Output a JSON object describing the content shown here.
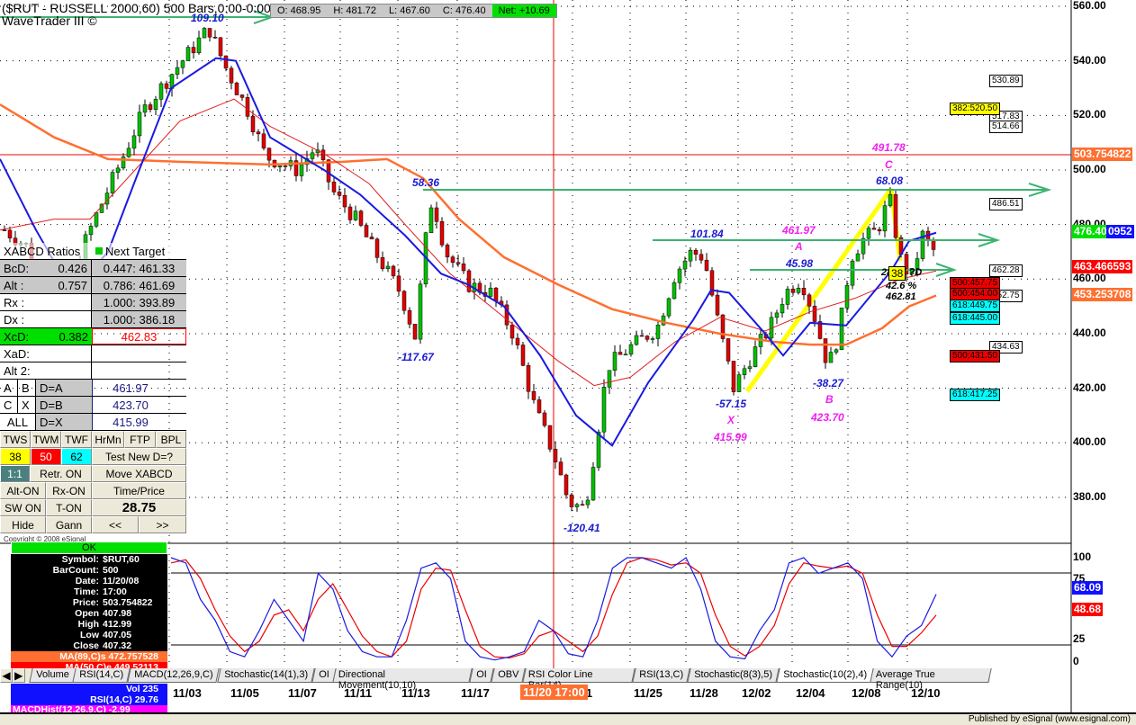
{
  "header": {
    "title": "($RUT - RUSSELL 2000,60) 500 Bars,0:00-0:00",
    "subtitle": "WaveTrader III ©",
    "open": "O: 468.95",
    "high": "H: 481.72",
    "low": "L: 467.60",
    "close": "C: 476.40",
    "net": "Net: +10.69"
  },
  "chart_data": {
    "type": "candlestick",
    "symbol": "$RUT",
    "interval": "60",
    "ylim": [
      370,
      562
    ],
    "y_ticks": [
      "560.00",
      "540.00",
      "520.00",
      "500.00",
      "480.00",
      "460.00",
      "440.00",
      "420.00",
      "400.00",
      "380.00"
    ],
    "x_ticks": [
      "11/03",
      "11/05",
      "11/07",
      "11/11",
      "11/13",
      "11/17",
      "/21",
      "11/25",
      "11/28",
      "12/02",
      "12/04",
      "12/08",
      "12/10"
    ],
    "cursor_label": "11/20 17:00",
    "price_path": [
      [
        5,
        478
      ],
      [
        30,
        472
      ],
      [
        55,
        448
      ],
      [
        75,
        446
      ],
      [
        90,
        470
      ],
      [
        105,
        482
      ],
      [
        130,
        500
      ],
      [
        160,
        522
      ],
      [
        190,
        535
      ],
      [
        215,
        545
      ],
      [
        232,
        552
      ],
      [
        250,
        538
      ],
      [
        275,
        522
      ],
      [
        295,
        505
      ],
      [
        330,
        500
      ],
      [
        350,
        508
      ],
      [
        370,
        492
      ],
      [
        395,
        482
      ],
      [
        420,
        468
      ],
      [
        445,
        455
      ],
      [
        462,
        438
      ],
      [
        470,
        468
      ],
      [
        480,
        490
      ],
      [
        495,
        470
      ],
      [
        520,
        458
      ],
      [
        545,
        455
      ],
      [
        570,
        440
      ],
      [
        595,
        412
      ],
      [
        615,
        396
      ],
      [
        632,
        378
      ],
      [
        650,
        376
      ],
      [
        662,
        400
      ],
      [
        675,
        428
      ],
      [
        700,
        435
      ],
      [
        730,
        442
      ],
      [
        750,
        462
      ],
      [
        768,
        470
      ],
      [
        782,
        468
      ],
      [
        795,
        448
      ],
      [
        815,
        420
      ],
      [
        835,
        432
      ],
      [
        855,
        442
      ],
      [
        872,
        455
      ],
      [
        890,
        460
      ],
      [
        905,
        446
      ],
      [
        920,
        428
      ],
      [
        932,
        440
      ],
      [
        945,
        468
      ],
      [
        960,
        475
      ],
      [
        975,
        478
      ],
      [
        988,
        490
      ],
      [
        1000,
        468
      ],
      [
        1012,
        460
      ],
      [
        1025,
        476
      ],
      [
        1038,
        470
      ]
    ],
    "ma_blue": [
      [
        0,
        504
      ],
      [
        40,
        478
      ],
      [
        80,
        455
      ],
      [
        120,
        470
      ],
      [
        150,
        496
      ],
      [
        190,
        530
      ],
      [
        240,
        541
      ],
      [
        262,
        540
      ],
      [
        300,
        512
      ],
      [
        360,
        500
      ],
      [
        400,
        491
      ],
      [
        450,
        476
      ],
      [
        490,
        462
      ],
      [
        520,
        458
      ],
      [
        560,
        450
      ],
      [
        600,
        432
      ],
      [
        640,
        410
      ],
      [
        680,
        399
      ],
      [
        720,
        422
      ],
      [
        770,
        445
      ],
      [
        790,
        456
      ],
      [
        810,
        455
      ],
      [
        850,
        440
      ],
      [
        870,
        432
      ],
      [
        900,
        444
      ],
      [
        940,
        443
      ],
      [
        965,
        453
      ],
      [
        990,
        463
      ],
      [
        1010,
        474
      ],
      [
        1040,
        477
      ]
    ],
    "ma_red": [
      [
        0,
        478
      ],
      [
        60,
        482
      ],
      [
        100,
        482
      ],
      [
        150,
        500
      ],
      [
        200,
        518
      ],
      [
        260,
        526
      ],
      [
        300,
        516
      ],
      [
        360,
        506
      ],
      [
        410,
        495
      ],
      [
        450,
        480
      ],
      [
        500,
        462
      ],
      [
        560,
        446
      ],
      [
        620,
        430
      ],
      [
        660,
        421
      ],
      [
        700,
        424
      ],
      [
        750,
        437
      ],
      [
        800,
        446
      ],
      [
        850,
        441
      ],
      [
        900,
        448
      ],
      [
        950,
        453
      ],
      [
        1000,
        460
      ],
      [
        1040,
        463
      ]
    ],
    "ma_orange": [
      [
        0,
        524
      ],
      [
        60,
        512
      ],
      [
        120,
        504
      ],
      [
        200,
        503
      ],
      [
        300,
        502
      ],
      [
        380,
        503
      ],
      [
        430,
        504
      ],
      [
        470,
        497
      ],
      [
        510,
        482
      ],
      [
        560,
        468
      ],
      [
        620,
        458
      ],
      [
        680,
        449
      ],
      [
        740,
        444
      ],
      [
        800,
        440
      ],
      [
        860,
        437
      ],
      [
        900,
        436
      ],
      [
        940,
        436
      ],
      [
        980,
        442
      ],
      [
        1010,
        450
      ],
      [
        1040,
        454
      ]
    ],
    "stoch_blue": [
      100,
      95,
      60,
      40,
      10,
      5,
      30,
      60,
      40,
      20,
      85,
      70,
      30,
      10,
      5,
      5,
      40,
      90,
      95,
      80,
      20,
      5,
      2,
      5,
      10,
      40,
      30,
      8,
      5,
      40,
      90,
      100,
      100,
      95,
      90,
      100,
      70,
      20,
      5,
      3,
      30,
      50,
      95,
      100,
      85,
      90,
      95,
      80,
      20,
      5,
      25,
      35,
      65
    ],
    "stoch_red": [
      95,
      98,
      80,
      50,
      25,
      10,
      20,
      45,
      50,
      30,
      60,
      75,
      50,
      25,
      10,
      5,
      20,
      70,
      90,
      88,
      50,
      15,
      5,
      4,
      8,
      25,
      30,
      20,
      10,
      25,
      65,
      95,
      100,
      98,
      93,
      95,
      85,
      45,
      15,
      6,
      15,
      35,
      75,
      95,
      92,
      90,
      92,
      85,
      45,
      15,
      15,
      28,
      45
    ],
    "stoch_ticks": [
      "100",
      "75",
      "25",
      "0"
    ]
  },
  "annotations": {
    "p109": "109.10",
    "p58": "58.36",
    "p117": "-117.67",
    "p120": "-120.41",
    "p101": "101.84",
    "p57": "-57.15",
    "x": "X",
    "x_val": "415.99",
    "p4598": "45.98",
    "a_val": "461.97",
    "a": "A",
    "p3827": "-38.27",
    "b": "B",
    "b_val": "423.70",
    "c_val": "491.78",
    "c": "C",
    "p6808": "68.08",
    "d_lbl": "28.87 ?D",
    "d_box": "38",
    "d_pct": "42.6 %",
    "d_val": "462.81",
    "copyright": "Copyright © 2008 eSignal"
  },
  "levels": {
    "l530": "530.89",
    "l382": "382:520.50",
    "l517": "517.83",
    "l514": "514.66",
    "l486": "486.51",
    "l462": "462.28",
    "l500a": "500:457.75",
    "l500b": "500:454.00",
    "l452": "452.75",
    "l618a": "618:449.75",
    "l618b": "618:445.00",
    "l434": "434.63",
    "l500c": "500:431.50",
    "l618c": "618:417.25"
  },
  "price_tags": {
    "cursor": "503.754822",
    "last": "476.40",
    "last_ext": "0952",
    "ma_red": "463.466593",
    "ma_orange": "453.253708",
    "stoch_blue": "68.09",
    "stoch_red": "48.68"
  },
  "panel": {
    "head1": "XABCD Ratios",
    "head2": "Next Target",
    "rows": [
      {
        "k": "BcD:",
        "v": "0.426",
        "t": "0.447: 461.33"
      },
      {
        "k": "Alt  :",
        "v": "0.757",
        "t": "0.786: 461.69"
      },
      {
        "k": "Rx   :",
        "v": "",
        "t": "1.000: 393.89"
      },
      {
        "k": "Dx   :",
        "v": "",
        "t": "1.000: 386.18"
      }
    ],
    "xcd_k": "XcD:",
    "xcd_v": "0.382",
    "xcd_t": "462.83",
    "xad": "XaD:",
    "alt2": "Alt 2:",
    "pairs": [
      {
        "a": "A",
        "b": "B",
        "d": "D=A",
        "v": "461.97"
      },
      {
        "a": "C",
        "b": "X",
        "d": "D=B",
        "v": "423.70"
      },
      {
        "a": "ALL",
        "b": "",
        "d": "D=X",
        "v": "415.99"
      }
    ],
    "btn1": [
      "TWS",
      "TWM",
      "TWF",
      "HrMn",
      "FTP",
      "BPL"
    ],
    "b38": "38",
    "b50": "50",
    "b62": "62",
    "test": "Test New D=?",
    "b11": "1:1",
    "retr": "Retr. ON",
    "move": "Move XABCD",
    "alt": "Alt-ON",
    "rx": "Rx-ON",
    "tp": "Time/Price",
    "sw": "SW ON",
    "t": "T-ON",
    "val": "28.75",
    "hide": "Hide",
    "gann": "Gann",
    "prev": "<<",
    "next": ">>"
  },
  "data_window": {
    "ok": "OK",
    "rows": [
      [
        "Symbol:",
        "$RUT,60"
      ],
      [
        "BarCount:",
        "500"
      ],
      [
        "Date:",
        "11/20/08"
      ],
      [
        "Time:",
        "17:00"
      ],
      [
        "Price:",
        "503.754822"
      ],
      [
        "Open",
        "407.98"
      ],
      [
        "High",
        "412.99"
      ],
      [
        "Low",
        "407.05"
      ],
      [
        "Close",
        "407.32"
      ]
    ],
    "ma89": "MA(89,C)s 472.757528",
    "ma50": "MA(50,C)e 449.52113"
  },
  "tabs": [
    "Volume",
    "RSI(14,C)",
    "MACD(12,26,9,C)",
    "Stochastic(14(1),3)",
    "OI",
    "Directional Movement(10,10)",
    "OI",
    "OBV",
    "RSI Color Line Bar(14)",
    "RSI(13,C)",
    "Stochastic(8(3),5)",
    "Stochastic(10(2),4)",
    "Average True Range(10)"
  ],
  "info": {
    "vol": "Vol 235",
    "rsi": "RSI(14,C) 29.76",
    "macd": "MACDHist(12,26,9,C) -2.99"
  },
  "status": "Published by eSignal (www.esignal.com)",
  "colors": {
    "up": "#00c000",
    "down": "#e00000",
    "blue_ma": "#1a1ae0",
    "red_ma": "#e02020",
    "orange_ma": "#ff7030",
    "arrow": "#3cb371"
  }
}
